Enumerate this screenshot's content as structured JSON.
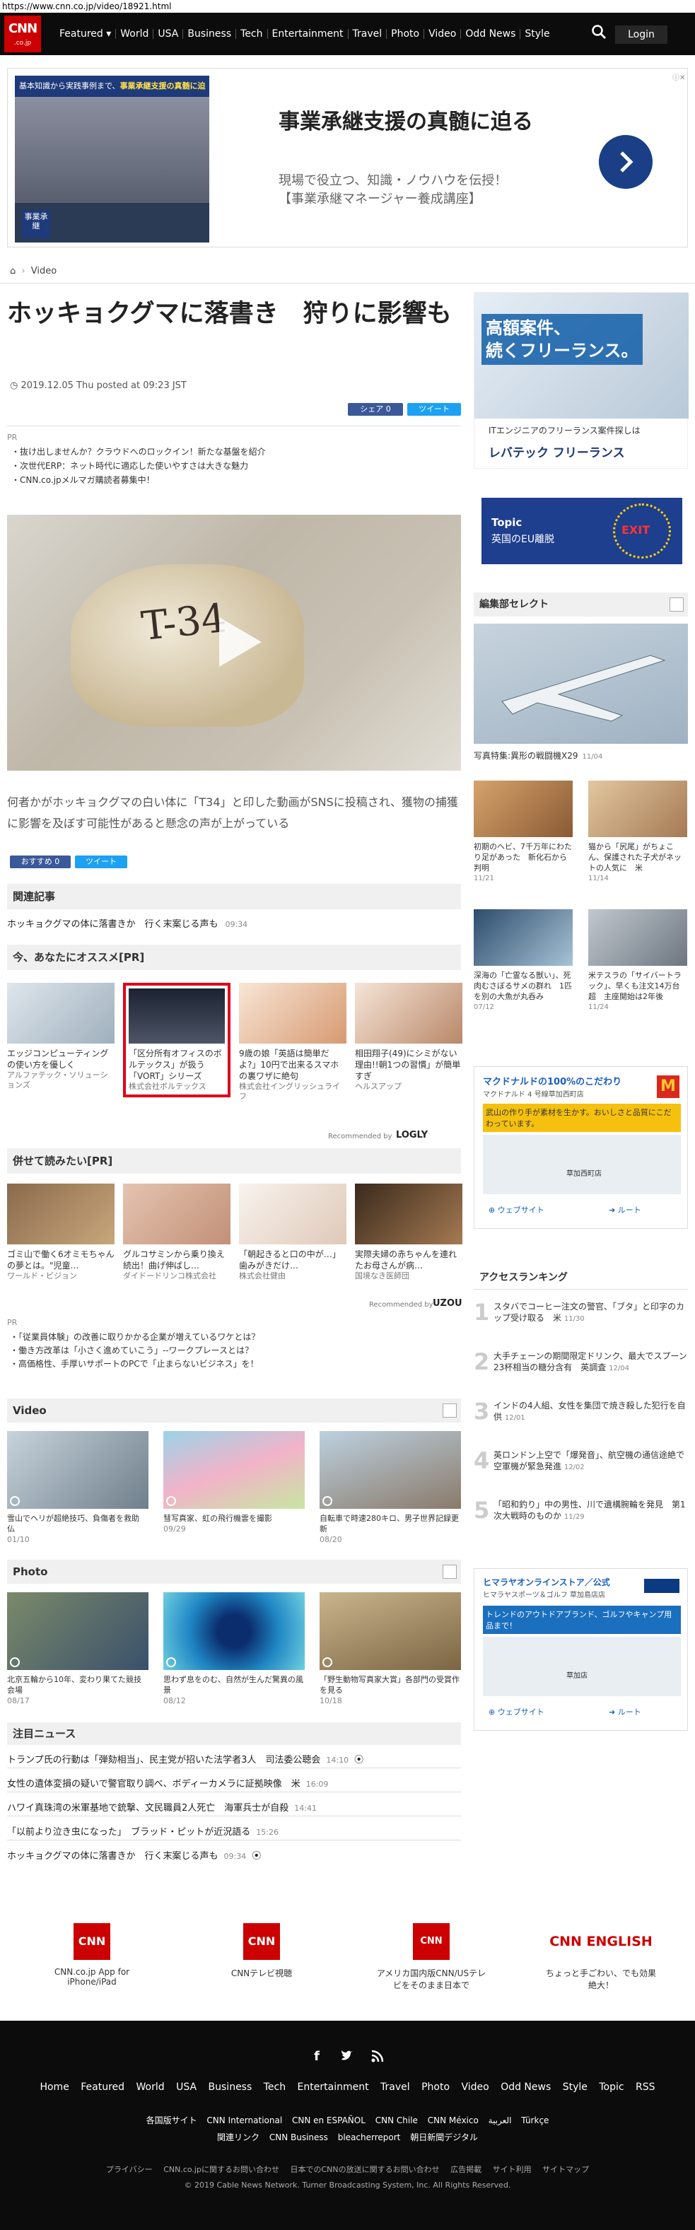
{
  "url": "https://www.cnn.co.jp/video/18921.html",
  "nav": {
    "logo_top": "CNN",
    "logo_bottom": ".co.jp",
    "items": [
      "Featured ▾",
      "World",
      "USA",
      "Business",
      "Tech",
      "Entertainment",
      "Travel",
      "Photo",
      "Video",
      "Odd News",
      "Style"
    ],
    "login": "Login"
  },
  "top_ad": {
    "strip": "基本知識から実践事例まで、",
    "strip_highlight": "事業承継支援の真髄に迫る!",
    "badge": "事業承継",
    "title": "事業承継支援の真髄に迫る",
    "desc_line1": "現場で役立つ、知識・ノウハウを伝授！",
    "desc_line2": "【事業承継マネージャー養成講座】"
  },
  "breadcrumb": "Video",
  "article": {
    "title": "ホッキョクグマに落書き　狩りに影響も",
    "date": "2019.12.05 Thu posted at 09:23 JST",
    "share_fb": "シェア 0",
    "share_tw": "ツイート",
    "video_text": "T-34",
    "lead": "何者かがホッキョクグマの白い体に「T34」と印した動画がSNSに投稿され、獲物の捕獲に影響を及ぼす可能性があると懸念の声が上がっている",
    "like_fb": "おすすめ 0",
    "like_tw": "ツイート"
  },
  "pr_block": {
    "label": "PR",
    "items": [
      "・抜け出しませんか？クラウドへのロックイン！新たな基盤を紹介",
      "・次世代ERP：ネット時代に適応した使いやすさは大きな魅力",
      "・CNN.co.jpメルマガ購読者募集中！"
    ]
  },
  "related": {
    "heading": "関連記事",
    "title": "ホッキョクグマの体に落書きか　行く末案じる声も",
    "time": "09:34"
  },
  "recommend": {
    "heading": "今、あなたにオススメ[PR]",
    "cards": [
      {
        "title": "エッジコンピューティングの使い方を優しく",
        "src": "アルファテック・ソリューションズ"
      },
      {
        "title": "「区分所有オフィスのボルテックス」が扱う「VORT」シリーズ",
        "src": "株式会社ボルテックス"
      },
      {
        "title": "9歳の娘「英語は簡単だよ?」10円で出来るスマホの裏ワザに絶句",
        "src": "株式会社イングリッシュライフ"
      },
      {
        "title": "相田翔子(49)にシミがない理由!!朝1つの習慣」が簡単すぎ",
        "src": "ヘルスアップ"
      }
    ],
    "footer_label": "Recommended by",
    "footer_brand": "LOGLY"
  },
  "read_together": {
    "heading": "併せて読みたい[PR]",
    "cards": [
      {
        "title": "ゴミ山で働く6才ミモちゃんの夢とは。\"児童…",
        "src": "ワールド・ビジョン"
      },
      {
        "title": "グルコサミンから乗り換え続出！曲げ伸ばし…",
        "src": "ダイドードリンコ株式会社"
      },
      {
        "title": "「朝起きると口の中が…」歯みがきだけ…",
        "src": "株式会社健由"
      },
      {
        "title": "実際夫婦の赤ちゃんを連れたお母さんが病…",
        "src": "国境なき医師団"
      }
    ],
    "footer_label": "Recommended by",
    "footer_brand": "UZOU"
  },
  "pr_bullets": {
    "label": "PR",
    "items": [
      "・「従業員体験」の改善に取りかかる企業が増えているワケとは？",
      "・働き方改革は「小さく進めていこう」--ワークプレースとは？",
      "・高価格性、手厚いサポートのPCで「止まらないビジネス」を！"
    ]
  },
  "video_section": {
    "heading": "Video",
    "cards": [
      {
        "title": "雪山でヘリが超絶技巧、負傷者を救助　仏",
        "time": "01/10"
      },
      {
        "title": "彗写真家、虹の飛行機雲を撮影",
        "time": "09/29"
      },
      {
        "title": "自転車で時速280キロ、男子世界記録更新",
        "time": "08/20"
      }
    ]
  },
  "photo_section": {
    "heading": "Photo",
    "cards": [
      {
        "title": "北京五輪から10年、変わり果てた競技会場",
        "time": "08/17"
      },
      {
        "title": "思わず息をのむ、自然が生んだ驚異の風景",
        "time": "08/12"
      },
      {
        "title": "「野生動物写真家大賞」各部門の受賞作を見る",
        "time": "10/18"
      }
    ]
  },
  "attention": {
    "heading": "注目ニュース",
    "items": [
      {
        "title": "トランプ氏の行動は「弾劾相当」、民主党が招いた法学者3人　司法委公聴会",
        "time": "14:10"
      },
      {
        "title": "女性の遺体変損の疑いで警官取り調べ、ボディーカメラに証拠映像　米",
        "time": "16:09"
      },
      {
        "title": "ハワイ真珠湾の米軍基地で銃撃、文民職員2人死亡　海軍兵士が自殺",
        "time": "14:41"
      },
      {
        "title": "「以前より泣き虫になった」　ブラッド・ピットが近況語る",
        "time": "15:26"
      },
      {
        "title": "ホッキョクグマの体に落書きか　行く末案じる声も",
        "time": "09:34"
      }
    ]
  },
  "right": {
    "ad1_text1": "高額案件、",
    "ad1_text2": "続くフリーランス。",
    "ad1_sub": "ITエンジニアのフリーランス案件探しは",
    "ad1_brand": "レバテック フリーランス",
    "topic_label": "Topic",
    "topic_title": "英国のEU離脱",
    "topic_exit": "EXIT",
    "editor_heading": "編集部セレクト",
    "feat_caption": "写真特集:異形の戦闘機X29",
    "feat_time": "11/04",
    "grid": [
      {
        "title": "初期のヘビ、7千万年にわたり足があった　新化石から判明",
        "time": "11/21"
      },
      {
        "title": "猫から「尻尾」がちょこん、保護された子犬がネットの人気に　米",
        "time": "11/14"
      },
      {
        "title": "深海の「亡霊なる獣い」、死肉むさぼるサメの群れ　1匹を別の大魚が丸呑み",
        "time": "07/12"
      },
      {
        "title": "米テスラの「サイバートラック」、早くも注文14万台超　主座開始は2年後",
        "time": "11/24"
      }
    ],
    "map_ad1_title": "マクドナルドの100%のこだわり",
    "map_ad1_sub": "マクドナルド 4 号線草加西町店",
    "map_ad1_banner": "武山の作り手が素材を生かす。おいしさと品質にこだわっています。",
    "map_ad1_place": "草加西町店",
    "map_website": "ウェブサイト",
    "map_route": "ルート",
    "ranking_heading": "アクセスランキング",
    "ranking": [
      {
        "title": "スタバでコーヒー注文の警官、「ブタ」と印字のカップ受け取る　米",
        "time": "11/30"
      },
      {
        "title": "大手チェーンの期間限定ドリンク、最大でスプーン23杯相当の糖分含有　英調査",
        "time": "12/04"
      },
      {
        "title": "インドの4人組、女性を集団で焼き殺した犯行を自供",
        "time": "12/01"
      },
      {
        "title": "英ロンドン上空で「爆発音」、航空機の通信途絶で空軍機が緊急発進",
        "time": "12/02"
      },
      {
        "title": "「昭和釣り」中の男性、川で遺構腕輪を発見　第1次大戦時のものか",
        "time": "11/29"
      }
    ],
    "map_ad2_title": "ヒマラヤオンラインストア／公式",
    "map_ad2_sub": "ヒマラヤスポーツ＆ゴルフ 草加島店店",
    "map_ad2_banner": "トレンドのアウトドアブランド、ゴルフやキャンプ用品まで！",
    "map_ad2_place": "草加店"
  },
  "apps": [
    {
      "badge": "CNN",
      "label": "CNN.co.jp App for iPhone/iPad"
    },
    {
      "badge": "CNN",
      "label": "CNNテレビ視聴"
    },
    {
      "badge": "CNN US",
      "label": "アメリカ国内版CNN/USテレビをそのまま日本で"
    },
    {
      "badge": "CNN ENGLISH",
      "label": "ちょっと手ごわい、でも効果絶大！"
    }
  ],
  "footer": {
    "nav": [
      "Home",
      "Featured",
      "World",
      "USA",
      "Business",
      "Tech",
      "Entertainment",
      "Travel",
      "Photo",
      "Video",
      "Odd News",
      "Style",
      "Topic",
      "RSS"
    ],
    "intl1": [
      "各国版サイト",
      "CNN International",
      "CNN en ESPAÑOL",
      "CNN Chile",
      "CNN México",
      "العربية",
      "Türkçe"
    ],
    "intl2": [
      "関連リンク",
      "CNN Business",
      "bleacherreport",
      "朝日新聞デジタル"
    ],
    "links": [
      "プライバシー",
      "CNN.co.jpに関するお問い合わせ",
      "日本でのCNNの放送に関するお問い合わせ",
      "広告掲載",
      "サイト利用",
      "サイトマップ"
    ],
    "copyright": "© 2019 Cable News Network. Turner Broadcasting System, Inc. All Rights Reserved."
  }
}
